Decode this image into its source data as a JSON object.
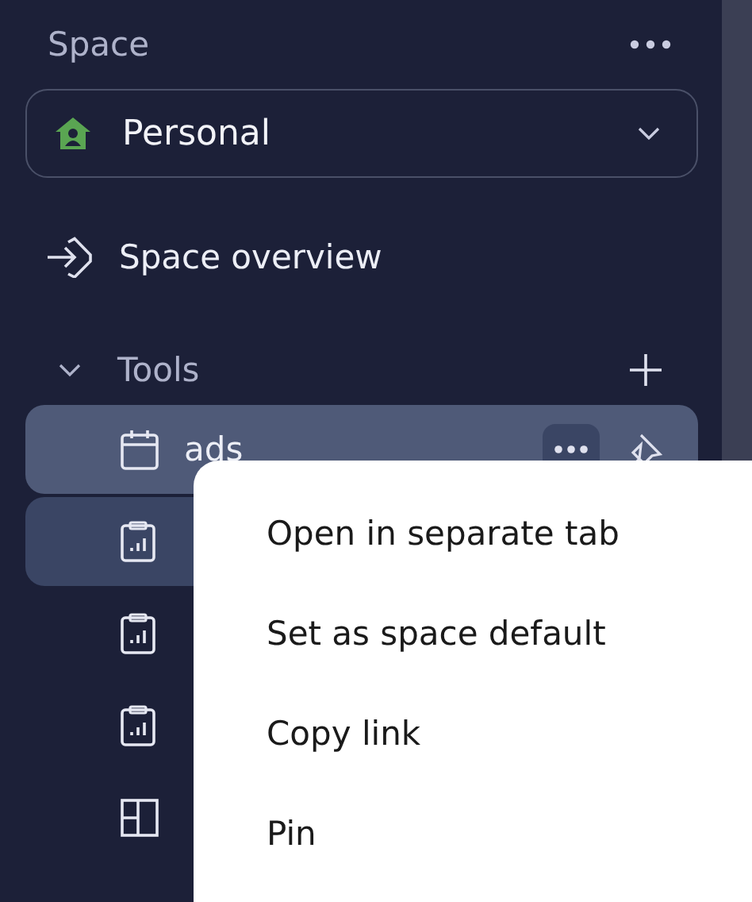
{
  "sidebar": {
    "title": "Space",
    "space_select": {
      "value": "Personal"
    },
    "overview": {
      "label": "Space overview"
    },
    "section": {
      "label": "Tools",
      "expanded": true,
      "items": [
        {
          "kind": "calendar",
          "label": "ads",
          "hovered": true,
          "selected": false
        },
        {
          "kind": "report",
          "selected": true,
          "hovered": false
        },
        {
          "kind": "report",
          "selected": false,
          "hovered": false
        },
        {
          "kind": "report",
          "selected": false,
          "hovered": false
        },
        {
          "kind": "board",
          "selected": false,
          "hovered": false
        }
      ]
    }
  },
  "context_menu": {
    "items": [
      "Open in separate tab",
      "Set as space default",
      "Copy link",
      "Pin"
    ]
  }
}
